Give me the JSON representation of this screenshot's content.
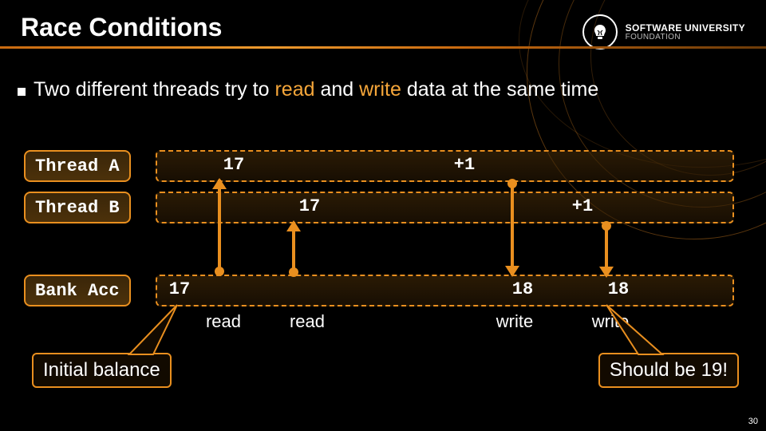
{
  "slide": {
    "title": "Race Conditions",
    "page_number": "30"
  },
  "bullet": {
    "pre": "Two different threads try to ",
    "read": "read",
    "mid": " and ",
    "write": "write",
    "post": " data at the same time"
  },
  "logo": {
    "line1a": "SOFTWARE",
    "line1b": "UNIVERSITY",
    "line2": "FOUNDATION"
  },
  "lanes": {
    "a": {
      "label": "Thread A",
      "read_value": "17",
      "op": "+1"
    },
    "b": {
      "label": "Thread B",
      "read_value": "17",
      "op": "+1"
    },
    "acc": {
      "label": "Bank Acc",
      "initial": "17",
      "after_a_write": "18",
      "after_b_write": "18"
    }
  },
  "actions": {
    "read_a": "read",
    "read_b": "read",
    "write_a": "write",
    "write_b": "write"
  },
  "callouts": {
    "initial": "Initial balance",
    "expected": "Should be 19!"
  },
  "colors": {
    "accent": "#e98f1f",
    "highlight_text": "#f5a63a"
  }
}
